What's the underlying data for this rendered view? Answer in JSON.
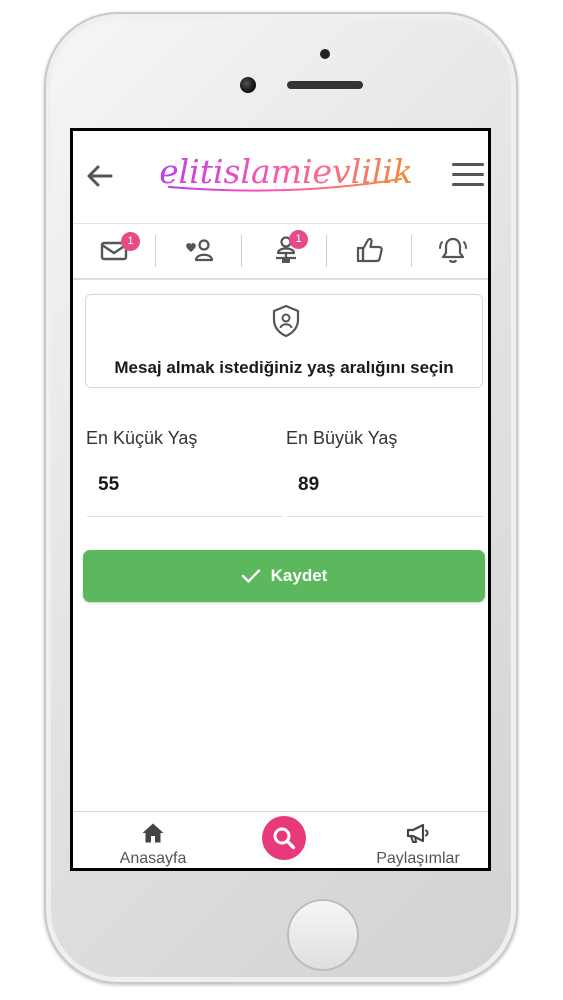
{
  "header": {
    "logo_text": "elitislamievlilik",
    "back_icon": "arrow-left-icon",
    "menu_icon": "hamburger-menu-icon"
  },
  "tabs": [
    {
      "name": "messages",
      "icon": "envelope-icon",
      "badge": "1"
    },
    {
      "name": "likes-me",
      "icon": "heart-user-icon",
      "badge": ""
    },
    {
      "name": "visitors",
      "icon": "user-network-icon",
      "badge": "1"
    },
    {
      "name": "liked",
      "icon": "thumbs-up-icon",
      "badge": ""
    },
    {
      "name": "notifications",
      "icon": "bell-icon",
      "badge": ""
    }
  ],
  "info": {
    "icon": "shield-user-icon",
    "text": "Mesaj almak istediğiniz yaş aralığını seçin"
  },
  "form": {
    "min_age_label": "En Küçük Yaş",
    "min_age_value": "55",
    "max_age_label": "En Büyük Yaş",
    "max_age_value": "89"
  },
  "save_button": {
    "label": "Kaydet",
    "icon": "check-icon"
  },
  "bottom_nav": {
    "home_label": "Anasayfa",
    "home_icon": "home-icon",
    "search_icon": "search-icon",
    "posts_label": "Paylaşımlar",
    "posts_icon": "megaphone-icon"
  },
  "colors": {
    "accent": "#e8397d",
    "badge": "#e84a87",
    "save_green": "#5cb85c"
  }
}
